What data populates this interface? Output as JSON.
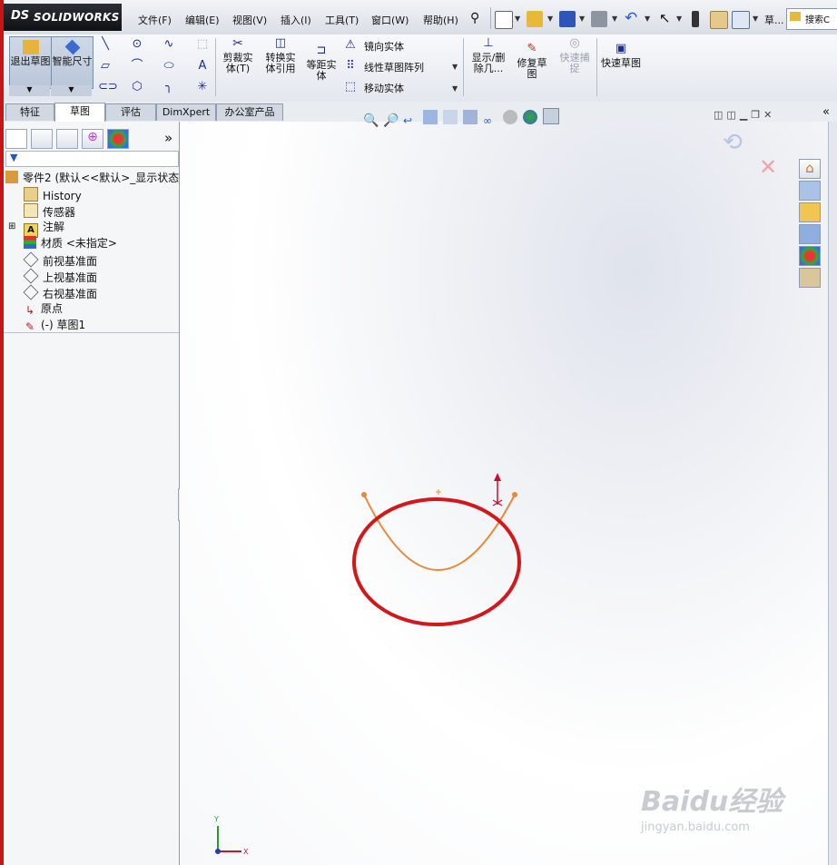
{
  "app": {
    "logo_ds": "DS",
    "logo_name": "SOLIDWORKS"
  },
  "menu": [
    "文件(F)",
    "编辑(E)",
    "视图(V)",
    "插入(I)",
    "工具(T)",
    "窗口(W)",
    "帮助(H)"
  ],
  "search_placeholder": "搜索C",
  "toolbar_truncated": "草...",
  "commands": {
    "exit_sketch": "退出草图",
    "smart_dim": "智能尺寸",
    "trim": "剪裁实体(T)",
    "convert": "转换实体引用",
    "offset": "等距实体",
    "mirror": "镜向实体",
    "linear_pattern": "线性草图阵列",
    "move": "移动实体",
    "show_delete": "显示/删除几...",
    "repair": "修复草图",
    "quick_snap": "快速捕捉",
    "rapid_sketch": "快速草图"
  },
  "tabs": [
    "特征",
    "草图",
    "评估",
    "DimXpert",
    "办公室产品"
  ],
  "active_tab": "草图",
  "tree": {
    "root": "零件2 (默认<<默认>_显示状态",
    "items": [
      "History",
      "传感器",
      "注解",
      "材质 <未指定>",
      "前视基准面",
      "上视基准面",
      "右视基准面",
      "原点",
      "(-) 草图1"
    ]
  },
  "colors": {
    "accent_red": "#d3181c",
    "sketch_orange": "#e8893a",
    "sw_red": "#c81414"
  },
  "triad": {
    "x": "X",
    "y": "Y"
  },
  "watermark": {
    "brand": "Baidu经验",
    "url": "jingyan.baidu.com"
  }
}
